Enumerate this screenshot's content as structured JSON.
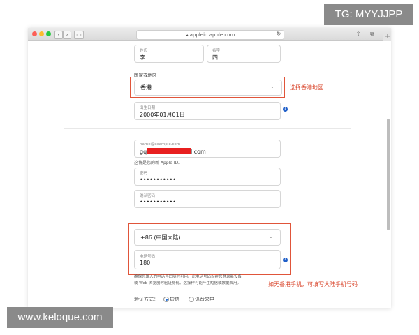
{
  "watermarks": {
    "top": "TG: MYYJJPP",
    "bottom": "www.keloque.com"
  },
  "browser": {
    "url": "appleid.apple.com",
    "back": "‹",
    "forward": "›"
  },
  "form": {
    "last_name": {
      "label": "姓氏",
      "value": "李"
    },
    "first_name": {
      "label": "名字",
      "value": "四"
    },
    "region": {
      "section_label": "国家或地区",
      "value": "香港",
      "note": "选择香港地区"
    },
    "birthday": {
      "label": "出生日期",
      "value": "2000年01月01日"
    },
    "email": {
      "label": "name@example.com",
      "value_start": "gq",
      "value_end": "l.com",
      "hint": "这将是您的新 Apple ID。"
    },
    "password": {
      "label": "密码",
      "value": "•••••••••••"
    },
    "confirm_password": {
      "label": "确认密码",
      "value": "•••••••••••"
    },
    "phone_code": {
      "value": "+86 (中国大陆)"
    },
    "phone": {
      "label": "电话号码",
      "value": "180",
      "note": "如无香港手机，可填写大陆手机号码"
    },
    "phone_desc_1": "确保您输入的电话号码随时可用。此电话号码以在您登录新设备",
    "phone_desc_2": "或 Web 浏览器时验证身份。这操作可能产生短信或数据费用。",
    "verify": {
      "label": "验证方式：",
      "option_sms": "短信",
      "option_call": "语音来电",
      "selected": "短信"
    }
  },
  "colors": {
    "annotation_red": "#e0553a",
    "help_blue": "#1f5fc9",
    "redaction": "#e81f1f"
  }
}
